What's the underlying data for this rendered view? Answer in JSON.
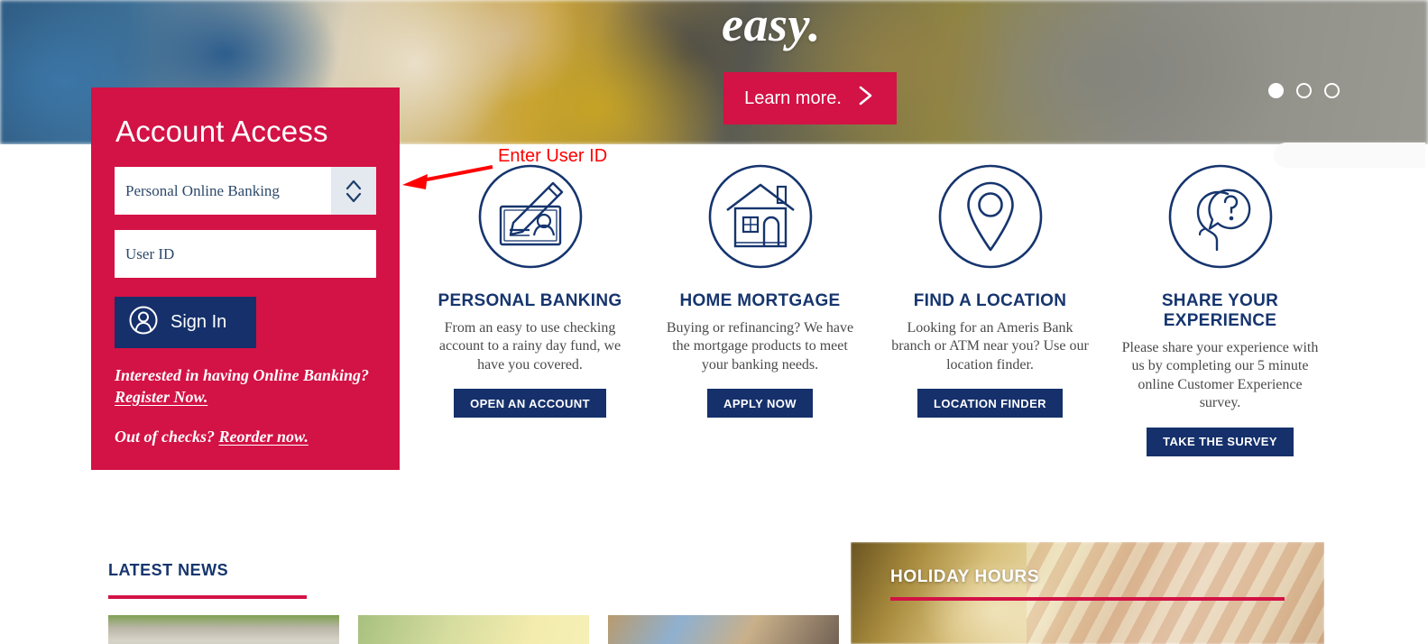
{
  "hero": {
    "headline_fragment": "easy.",
    "learn_more_label": "Learn more.",
    "chevron_icon": "chevron-right-icon",
    "carousel": {
      "total_slides": 3,
      "active_slide": 1
    }
  },
  "account_access": {
    "title": "Account Access",
    "account_type_select": {
      "selected": "Personal Online Banking",
      "stepper_icon": "stepper-up-down-icon"
    },
    "user_id_input": {
      "placeholder": "User ID",
      "value": ""
    },
    "sign_in": {
      "label": "Sign In",
      "icon": "user-circle-icon"
    },
    "register_prompt": "Interested in having Online Banking?",
    "register_link": "Register Now.",
    "reorder_prompt": "Out of checks?",
    "reorder_link": "Reorder now."
  },
  "annotation": {
    "label": "Enter User ID",
    "color": "#FF0000",
    "arrow_icon": "arrow-left-icon"
  },
  "cards": [
    {
      "icon": "check-pencil-icon",
      "title": "PERSONAL BANKING",
      "description": "From an easy to use checking account to a rainy day fund, we have you covered.",
      "button": "OPEN AN ACCOUNT"
    },
    {
      "icon": "house-icon",
      "title": "HOME MORTGAGE",
      "description": "Buying or refinancing? We have the mortgage products to meet your banking needs.",
      "button": "APPLY NOW"
    },
    {
      "icon": "map-pin-icon",
      "title": "FIND A LOCATION",
      "description": "Looking for an Ameris Bank branch or ATM near you? Use our location finder.",
      "button": "LOCATION FINDER"
    },
    {
      "icon": "head-question-icon",
      "title": "SHARE YOUR EXPERIENCE",
      "description": "Please share your experience with us by completing our 5 minute online Customer Experience survey.",
      "button": "TAKE THE SURVEY"
    }
  ],
  "latest_news": {
    "heading": "LATEST NEWS"
  },
  "holiday_hours": {
    "heading": "HOLIDAY HOURS"
  },
  "colors": {
    "crimson": "#D31245",
    "navy": "#15306B",
    "heading_navy": "#16356E",
    "annotation_red": "#FF0000"
  }
}
